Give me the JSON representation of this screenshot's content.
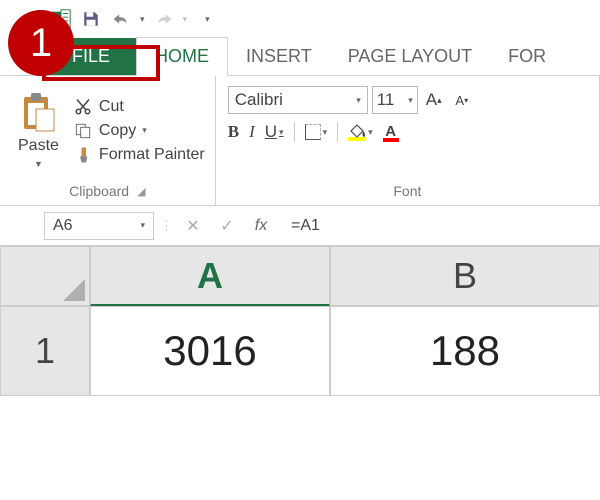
{
  "annotation": {
    "number": "1"
  },
  "qat": {
    "items": [
      "excel-logo",
      "save",
      "undo",
      "redo",
      "customize"
    ]
  },
  "tabs": {
    "file": "FILE",
    "home": "HOME",
    "insert": "INSERT",
    "page_layout": "PAGE LAYOUT",
    "formulas": "FOR"
  },
  "ribbon": {
    "clipboard": {
      "paste": "Paste",
      "cut": "Cut",
      "copy": "Copy",
      "format_painter": "Format Painter",
      "group_label": "Clipboard"
    },
    "font": {
      "name": "Calibri",
      "size": "11",
      "bold": "B",
      "italic": "I",
      "underline": "U",
      "group_label": "Font"
    }
  },
  "formula_bar": {
    "name_box": "A6",
    "fx_label": "fx",
    "formula": "=A1"
  },
  "grid": {
    "columns": [
      "A",
      "B"
    ],
    "rows": [
      "1"
    ],
    "cells": {
      "A1": "3016",
      "B1": "188"
    }
  }
}
